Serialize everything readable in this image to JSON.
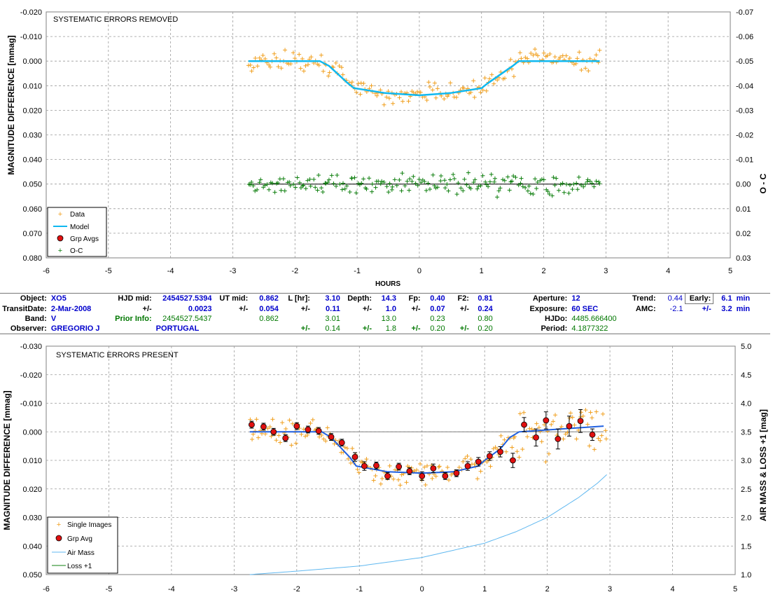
{
  "chart_data": [
    {
      "type": "scatter",
      "title": "SYSTEMATIC ERRORS REMOVED",
      "xlabel": "HOURS",
      "ylabel": "MAGNITUDE DIFFERENCE [mmag]",
      "y2label": "O - C",
      "xlim": [
        -6,
        5
      ],
      "ylim": [
        -0.02,
        0.08
      ],
      "y2lim": [
        -0.07,
        0.03
      ],
      "y_reversed": true,
      "y2_reversed": true,
      "grid": true,
      "legend_position": "bottom-left",
      "x_ticks": [
        "-6",
        "-5",
        "-4",
        "-3",
        "-2",
        "-1",
        "0",
        "1",
        "2",
        "3",
        "4",
        "5"
      ],
      "y_ticks": [
        "-0.020",
        "-0.010",
        "0.000",
        "0.010",
        "0.020",
        "0.030",
        "0.040",
        "0.050",
        "0.060",
        "0.070",
        "0.080"
      ],
      "y2_ticks": [
        "-0.07",
        "-0.06",
        "-0.05",
        "-0.04",
        "-0.03",
        "-0.02",
        "-0.01",
        "0.00",
        "0.01",
        "0.02",
        "0.03"
      ],
      "legend": [
        "Data",
        "Model",
        "Grp Avgs",
        "O-C"
      ],
      "colors": {
        "data": "#f0a020",
        "model": "#10b8f0",
        "grp": "#e01010",
        "oc": "#108010",
        "zero": "#000000"
      },
      "model": {
        "x": [
          -2.75,
          -1.6,
          -1.45,
          -1.15,
          -1.05,
          -0.55,
          0.0,
          0.5,
          1.0,
          1.1,
          1.5,
          1.6,
          2.9
        ],
        "y": [
          0.0,
          0.0,
          0.002,
          0.009,
          0.011,
          0.013,
          0.0139,
          0.013,
          0.011,
          0.009,
          0.002,
          0.0,
          0.0
        ]
      },
      "series": [
        {
          "name": "Data",
          "marker": "plus",
          "x_range": [
            -2.75,
            2.9
          ],
          "points": 190
        },
        {
          "name": "O-C",
          "marker": "plus",
          "x_range": [
            -2.75,
            2.9
          ],
          "points": 190,
          "y_center": 0.0
        }
      ]
    },
    {
      "type": "scatter",
      "title": "SYSTEMATIC ERRORS PRESENT",
      "ylabel": "MAGNITUDE DIFFERENCE [mmag]",
      "y2label": "AIR MASS & LOSS +1 [mag]",
      "xlim": [
        -6,
        5
      ],
      "ylim": [
        -0.03,
        0.05
      ],
      "y2lim": [
        1.0,
        5.0
      ],
      "y_reversed": true,
      "grid": true,
      "legend_position": "bottom-left",
      "x_ticks": [
        "-6",
        "-5",
        "-4",
        "-3",
        "-2",
        "-1",
        "0",
        "1",
        "2",
        "3",
        "4",
        "5"
      ],
      "y_ticks": [
        "-0.030",
        "-0.020",
        "-0.010",
        "0.000",
        "0.010",
        "0.020",
        "0.030",
        "0.040",
        "0.050"
      ],
      "y2_ticks": [
        "1.0",
        "1.5",
        "2.0",
        "2.5",
        "3.0",
        "3.5",
        "4.0",
        "4.5",
        "5.0"
      ],
      "legend": [
        "Single Images",
        "Grp Avg",
        "Air Mass",
        "Loss +1"
      ],
      "colors": {
        "data": "#f0a020",
        "model": "#2060e0",
        "grp": "#e01010",
        "airmass": "#60b8f0",
        "loss": "#108010",
        "ref": "#808080"
      },
      "group_averages": [
        {
          "x": -2.72,
          "y": -0.0025,
          "e": 0.0012
        },
        {
          "x": -2.53,
          "y": -0.0018,
          "e": 0.0012
        },
        {
          "x": -2.37,
          "y": 0.0,
          "e": 0.0012
        },
        {
          "x": -2.18,
          "y": 0.0022,
          "e": 0.0012
        },
        {
          "x": -2.0,
          "y": -0.002,
          "e": 0.0012
        },
        {
          "x": -1.82,
          "y": -0.0008,
          "e": 0.0012
        },
        {
          "x": -1.65,
          "y": -0.0003,
          "e": 0.0012
        },
        {
          "x": -1.45,
          "y": 0.0018,
          "e": 0.0012
        },
        {
          "x": -1.28,
          "y": 0.0038,
          "e": 0.0012
        },
        {
          "x": -1.07,
          "y": 0.0088,
          "e": 0.0015
        },
        {
          "x": -0.92,
          "y": 0.012,
          "e": 0.0015
        },
        {
          "x": -0.73,
          "y": 0.0118,
          "e": 0.0012
        },
        {
          "x": -0.55,
          "y": 0.0155,
          "e": 0.0012
        },
        {
          "x": -0.37,
          "y": 0.0122,
          "e": 0.0012
        },
        {
          "x": -0.2,
          "y": 0.0138,
          "e": 0.0012
        },
        {
          "x": 0.0,
          "y": 0.0155,
          "e": 0.0015
        },
        {
          "x": 0.18,
          "y": 0.0128,
          "e": 0.0015
        },
        {
          "x": 0.37,
          "y": 0.0155,
          "e": 0.0012
        },
        {
          "x": 0.55,
          "y": 0.0145,
          "e": 0.0012
        },
        {
          "x": 0.73,
          "y": 0.012,
          "e": 0.0015
        },
        {
          "x": 0.9,
          "y": 0.0105,
          "e": 0.0015
        },
        {
          "x": 1.08,
          "y": 0.0085,
          "e": 0.0015
        },
        {
          "x": 1.25,
          "y": 0.007,
          "e": 0.0018
        },
        {
          "x": 1.45,
          "y": 0.01,
          "e": 0.0025
        },
        {
          "x": 1.63,
          "y": -0.0025,
          "e": 0.0025
        },
        {
          "x": 1.82,
          "y": 0.002,
          "e": 0.003
        },
        {
          "x": 1.98,
          "y": -0.004,
          "e": 0.003
        },
        {
          "x": 2.17,
          "y": 0.0025,
          "e": 0.0035
        },
        {
          "x": 2.35,
          "y": -0.002,
          "e": 0.0035
        },
        {
          "x": 2.53,
          "y": -0.0038,
          "e": 0.004
        },
        {
          "x": 2.72,
          "y": 0.001,
          "e": 0.002
        }
      ],
      "model": {
        "x": [
          -2.75,
          -1.6,
          -1.45,
          -1.15,
          -1.05,
          -0.55,
          0.0,
          0.5,
          0.9,
          1.0,
          1.25,
          1.4,
          1.55,
          2.9
        ],
        "y": [
          0.0,
          0.0,
          0.002,
          0.009,
          0.012,
          0.014,
          0.0145,
          0.014,
          0.012,
          0.01,
          0.006,
          0.002,
          0.0,
          -0.002
        ]
      },
      "airmass": {
        "x": [
          -2.75,
          -2,
          -1,
          0,
          1,
          1.5,
          2,
          2.5,
          2.8,
          2.95
        ],
        "y": [
          1.0,
          1.06,
          1.15,
          1.3,
          1.55,
          1.75,
          2.0,
          2.35,
          2.6,
          2.75
        ]
      }
    }
  ],
  "info": {
    "object_label": "Object:",
    "object": "XO5",
    "transit_date_label": "TransitDate:",
    "transit_date": "2-Mar-2008",
    "band_label": "Band:",
    "band": "V",
    "observer_label": "Observer:",
    "observer": "GREGORIO J",
    "hjd_mid_label": "HJD mid:",
    "hjd_mid": "2454527.5394",
    "pm": "+/-",
    "hjd_mid_err": "0.0023",
    "prior_info_label": "Prior Info:",
    "prior_hjd": "2454527.5437",
    "location": "PORTUGAL",
    "ut_mid_label": "UT mid:",
    "ut_mid": "0.862",
    "ut_mid_err": "0.054",
    "ut_mid_prior": "0.862",
    "length_label": "L [hr]:",
    "length": "3.10",
    "length_err": "0.11",
    "length_prior": "3.01",
    "length_prior_err": "0.14",
    "depth_label": "Depth:",
    "depth": "14.3",
    "depth_err": "1.0",
    "depth_prior": "13.0",
    "depth_prior_err": "1.8",
    "fp_label": "Fp:",
    "fp": "0.40",
    "fp_err": "0.07",
    "fp_prior": "0.23",
    "fp_prior_err": "0.20",
    "f2_label": "F2:",
    "f2": "0.81",
    "f2_err": "0.24",
    "f2_prior": "0.80",
    "f2_prior_err": "0.20",
    "aperture_label": "Aperture:",
    "aperture": "12",
    "exposure_label": "Exposure:",
    "exposure": "60 SEC",
    "hjdo_label": "HJDo:",
    "hjdo": "4485.666400",
    "period_label": "Period:",
    "period": "4.1877322",
    "trend_label": "Trend:",
    "trend": "0.44",
    "amc_label": "AMC:",
    "amc": "-2.1",
    "early_label": "Early:",
    "early": "6.1",
    "early_err": "3.2",
    "unit_min": "min"
  }
}
